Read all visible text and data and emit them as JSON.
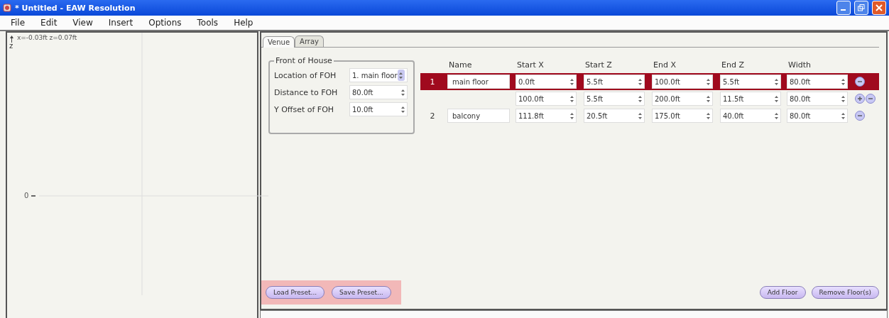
{
  "window": {
    "title": "* Untitled - EAW Resolution"
  },
  "menu": [
    "File",
    "Edit",
    "View",
    "Insert",
    "Options",
    "Tools",
    "Help"
  ],
  "plot": {
    "readout": "x=-0.03ft z=0.07ft",
    "axis_label": "z",
    "zero_label": "0"
  },
  "tabs": [
    {
      "label": "Venue",
      "selected": true
    },
    {
      "label": "Array",
      "selected": false
    }
  ],
  "foh": {
    "title": "Front of House",
    "fields": [
      {
        "label": "Location of FOH",
        "value": "1. main floor",
        "kind": "select"
      },
      {
        "label": "Distance to FOH",
        "value": "80.0ft",
        "kind": "spinner"
      },
      {
        "label": "Y Offset of FOH",
        "value": "10.0ft",
        "kind": "spinner"
      }
    ]
  },
  "floors": {
    "columns": [
      "Name",
      "Start X",
      "Start Z",
      "End X",
      "End Z",
      "Width"
    ],
    "rows": [
      {
        "number": "1",
        "name": "main floor",
        "selected": true,
        "values": [
          "0.0ft",
          "5.5ft",
          "100.0ft",
          "5.5ft",
          "80.0ft"
        ],
        "kind": "remove"
      },
      {
        "selected": false,
        "values": [
          "100.0ft",
          "5.5ft",
          "200.0ft",
          "11.5ft",
          "80.0ft"
        ],
        "kind": "add-remove"
      },
      {
        "number": "2",
        "name": "balcony",
        "selected": false,
        "values": [
          "111.8ft",
          "20.5ft",
          "175.0ft",
          "40.0ft",
          "80.0ft"
        ],
        "kind": "remove"
      }
    ]
  },
  "preset_buttons": [
    "Load Preset...",
    "Save Preset..."
  ],
  "floor_buttons": [
    "Add Floor",
    "Remove Floor(s)"
  ]
}
